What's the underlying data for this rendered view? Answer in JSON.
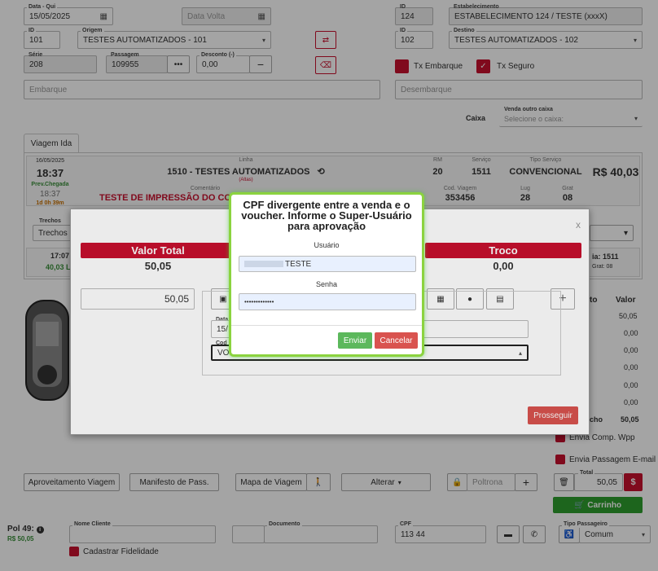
{
  "top": {
    "data_label": "Data - Qui",
    "data_value": "15/05/2025",
    "data_volta_placeholder": "Data Volta",
    "id_left_label": "ID",
    "id_left_value": "101",
    "origem_label": "Origem",
    "origem_value": "TESTES AUTOMATIZADOS - 101",
    "serie_label": "Série",
    "serie_value": "208",
    "passagem_label": "Passagem",
    "passagem_value": "109955",
    "desconto_label": "Desconto (-)",
    "desconto_value": "0,00",
    "embarque_placeholder": "Embarque",
    "id_est_label": "ID",
    "id_est_value": "124",
    "estabelecimento_label": "Estabelecimento",
    "estabelecimento_value": "ESTABELECIMENTO 124 / TESTE (xxxX)",
    "id_right_label": "ID",
    "id_right_value": "102",
    "destino_label": "Destino",
    "destino_value": "TESTES AUTOMATIZADOS - 102",
    "tx_embarque": "Tx Embarque",
    "tx_seguro": "Tx Seguro",
    "desembarque_placeholder": "Desembarque",
    "caixa_label": "Caixa",
    "venda_outro_caixa_label": "Venda outro caixa",
    "venda_outro_caixa_placeholder": "Selecione o caixa:"
  },
  "trip": {
    "tab": "Viagem Ida",
    "date": "16/05/2025",
    "time": "18:37",
    "prev_chegada_label": "Prev.Chegada",
    "prev_chegada_time": "18:37",
    "duration": "1d 0h 39m",
    "linha_label": "Linha",
    "linha_value": "1510 - TESTES AUTOMATIZADOS",
    "linha_note": "(Altas)",
    "comentario_label": "Comentário",
    "comentario_value": "TESTE DE IMPRESSÃO DO COME",
    "rm_label": "RM",
    "rm_value": "20",
    "servico_label": "Serviço",
    "servico_value": "1511",
    "tipo_servico_label": "Tipo Serviço",
    "tipo_servico_value": "CONVENCIONAL",
    "price": "R$ 40,03",
    "cod_viagem_label": "Cod. Viagem",
    "cod_viagem_value": "353456",
    "lug_label": "Lug",
    "lug_value": "28",
    "grat_label": "Grat",
    "grat_value": "08",
    "trechos_label": "Trechos",
    "trechos_value": "Trechos",
    "row2_time": "17:07",
    "row2_price": "40,03 L",
    "row2_right": "ia: 1511",
    "row2_grat": "Grat: 08"
  },
  "payment_modal": {
    "close": "x",
    "valor_total_label": "Valor Total",
    "valor_total_value": "50,05",
    "troco_label": "Troco",
    "troco_value": "0,00",
    "amount_input": "50,05",
    "data_label": "Data",
    "data_value": "15/",
    "cod_label": "Cod",
    "select_value": "VO",
    "prosseguir": "Prosseguir",
    "plus": "+",
    "valor_col": "Valor",
    "to_col": "to",
    "values": [
      "50,05",
      "0,00",
      "0,00",
      "0,00",
      "0,00",
      "0,00"
    ],
    "cho_label": "cho",
    "cho_value": "50,05"
  },
  "approval_modal": {
    "title": "CPF divergente entre a venda e o voucher. Informe o Super-Usuário para aprovação",
    "usuario_label": "Usuário",
    "usuario_value": "TESTE",
    "senha_label": "Senha",
    "senha_value": "•••••••••••••",
    "enviar": "Enviar",
    "cancelar": "Cancelar"
  },
  "right_checks": {
    "envia_comp": "Envia Comp. Wpp",
    "envia_passagem": "Envia Passagem E-mail"
  },
  "actions": {
    "aproveitamento": "Aproveitamento Viagem",
    "manifesto": "Manifesto de Pass.",
    "mapa": "Mapa de Viagem",
    "alterar": "Alterar",
    "poltrona_placeholder": "Poltrona",
    "total_label": "Total",
    "total_value": "50,05",
    "currency_btn": "$",
    "carrinho": "Carrinho"
  },
  "bottom": {
    "pol_label": "Pol 49:",
    "pol_price": "R$ 50,05",
    "nome_cliente_label": "Nome Cliente",
    "documento_label": "Documento",
    "cpf_label": "CPF",
    "cpf_value": "113        44",
    "tipo_passageiro_label": "Tipo Passageiro",
    "tipo_passageiro_value": "Comum",
    "cadastrar_fidelidade": "Cadastrar Fidelidade"
  },
  "colors": {
    "brand_red": "#c8102e",
    "success": "#5cb85c",
    "danger": "#d9534f",
    "highlight": "#8bd33f"
  }
}
